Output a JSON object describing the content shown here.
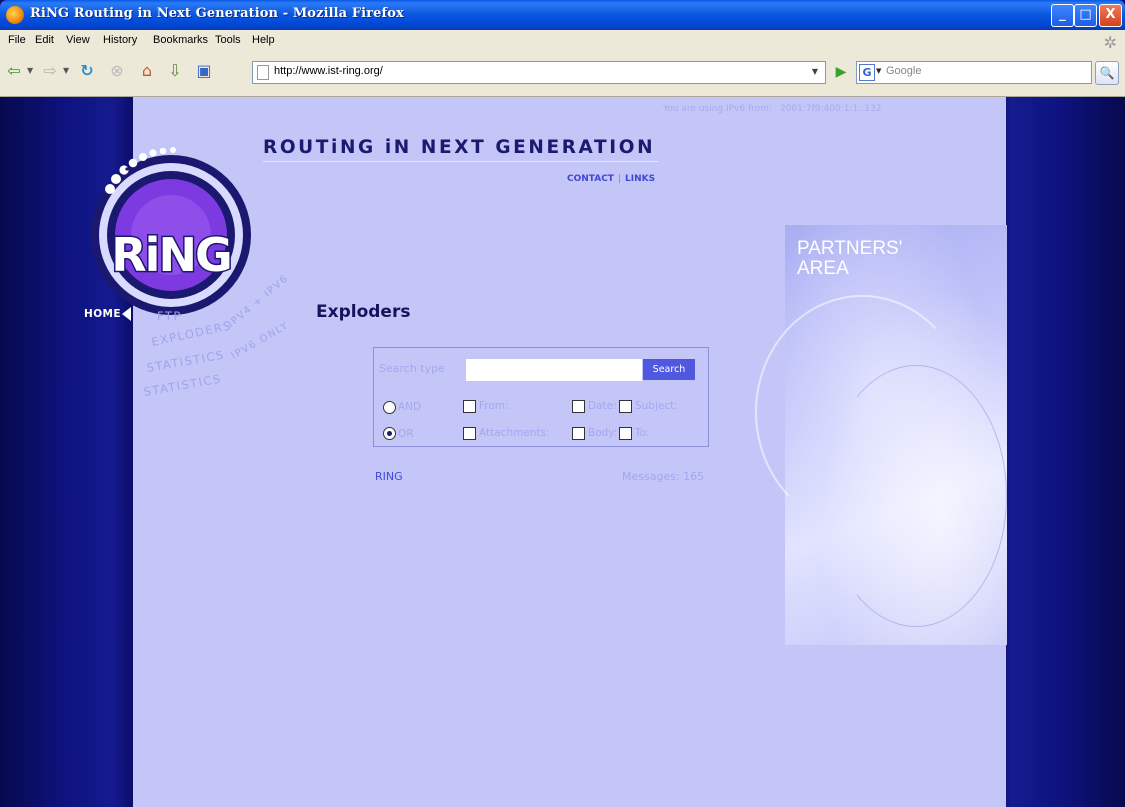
{
  "window": {
    "title": "RiNG Routing in Next Generation - Mozilla Firefox",
    "controls": {
      "minimize": "_",
      "maximize": "□",
      "close": "X"
    }
  },
  "menubar": {
    "items": [
      "File",
      "Edit",
      "View",
      "History",
      "Bookmarks",
      "Tools",
      "Help"
    ]
  },
  "toolbar": {
    "url": "http://www.ist-ring.org/",
    "search_placeholder": "Google",
    "search_engine_icon": "G"
  },
  "page": {
    "ipv6_notice_label": "You are using IPv6 from:",
    "ipv6_address": "2001:7f9:400:1:1::132",
    "headline": "ROUTiNG iN NEXT GENERATION",
    "links": [
      "CONTACT",
      "LINKS"
    ],
    "logo_text": "RiNG",
    "nav": {
      "home": "HOME",
      "items": [
        "FTP",
        "EXPLODERS",
        "IPV4 + IPV6",
        "STATISTICS",
        "IPV6 ONLY",
        "STATISTICS"
      ]
    },
    "partners_area": "PARTNERS' AREA",
    "title": "Exploders",
    "search": {
      "type_label": "Search type",
      "input_value": "",
      "button": "Search",
      "options": {
        "and": "AND",
        "or": "OR",
        "from": "From:",
        "date": "Date:",
        "subject": "Subject:",
        "attachments": "Attachments:",
        "body": "Body:",
        "to": "To:"
      },
      "selected_mode": "OR"
    },
    "list_name": "RING",
    "messages_label": "Messages: 165"
  },
  "colors": {
    "page_background": "#c4c6f8",
    "outer_background": "#0a0d6a",
    "accent_link": "#3f48d6",
    "search_button": "#5158e0"
  }
}
